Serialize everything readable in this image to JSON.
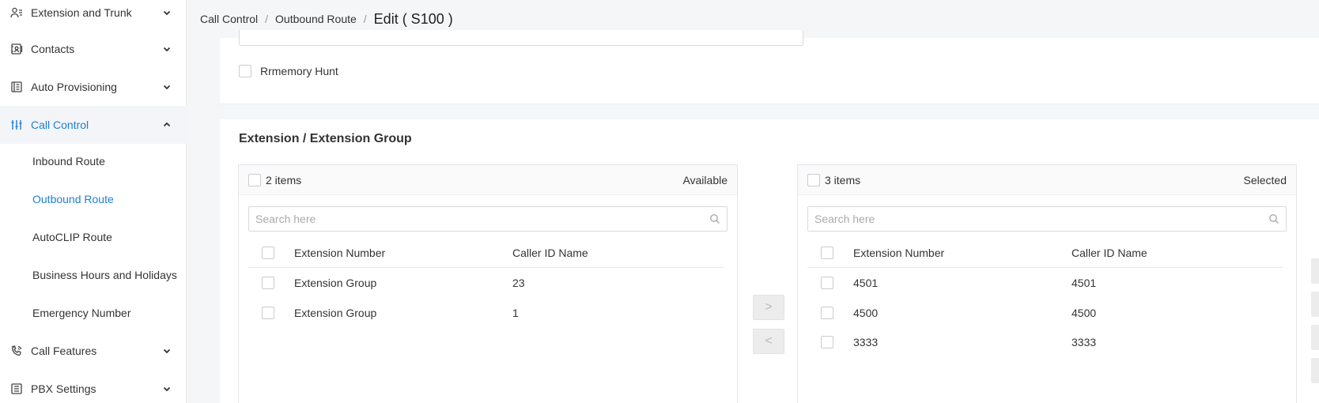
{
  "sidebar": {
    "items": [
      {
        "label": "Extension and Trunk",
        "icon": "extension-trunk-icon",
        "expanded": false
      },
      {
        "label": "Contacts",
        "icon": "contacts-icon",
        "expanded": false
      },
      {
        "label": "Auto Provisioning",
        "icon": "auto-provisioning-icon",
        "expanded": false
      },
      {
        "label": "Call Control",
        "icon": "call-control-icon",
        "expanded": true
      },
      {
        "label": "Call Features",
        "icon": "call-features-icon",
        "expanded": false
      },
      {
        "label": "PBX Settings",
        "icon": "pbx-settings-icon",
        "expanded": false
      }
    ],
    "call_control_sub": [
      {
        "label": "Inbound Route"
      },
      {
        "label": "Outbound Route"
      },
      {
        "label": "AutoCLIP Route"
      },
      {
        "label": "Business Hours and Holidays"
      },
      {
        "label": "Emergency Number"
      }
    ]
  },
  "breadcrumb": {
    "items": [
      "Call Control",
      "Outbound Route"
    ],
    "separator": "/",
    "current": "Edit ( S100 )"
  },
  "form": {
    "rrmemory_hunt_label": "Rrmemory Hunt",
    "rrmemory_hunt_checked": false
  },
  "extension_section": {
    "title": "Extension / Extension Group",
    "available": {
      "count_label": "2 items",
      "side_label": "Available",
      "search_placeholder": "Search here",
      "columns": [
        "Extension Number",
        "Caller ID Name"
      ],
      "rows": [
        {
          "number": "Extension Group",
          "name": "23"
        },
        {
          "number": "Extension Group",
          "name": "1"
        }
      ]
    },
    "move_right_label": ">",
    "move_left_label": "<",
    "selected": {
      "count_label": "3 items",
      "side_label": "Selected",
      "search_placeholder": "Search here",
      "columns": [
        "Extension Number",
        "Caller ID Name"
      ],
      "rows": [
        {
          "number": "4501",
          "name": "4501"
        },
        {
          "number": "4500",
          "name": "4500"
        },
        {
          "number": "3333",
          "name": "3333"
        }
      ]
    }
  },
  "colors": {
    "accent": "#1f7fd6",
    "background": "#f4f6f8",
    "active_nav_bg": "#f3f5f8"
  }
}
